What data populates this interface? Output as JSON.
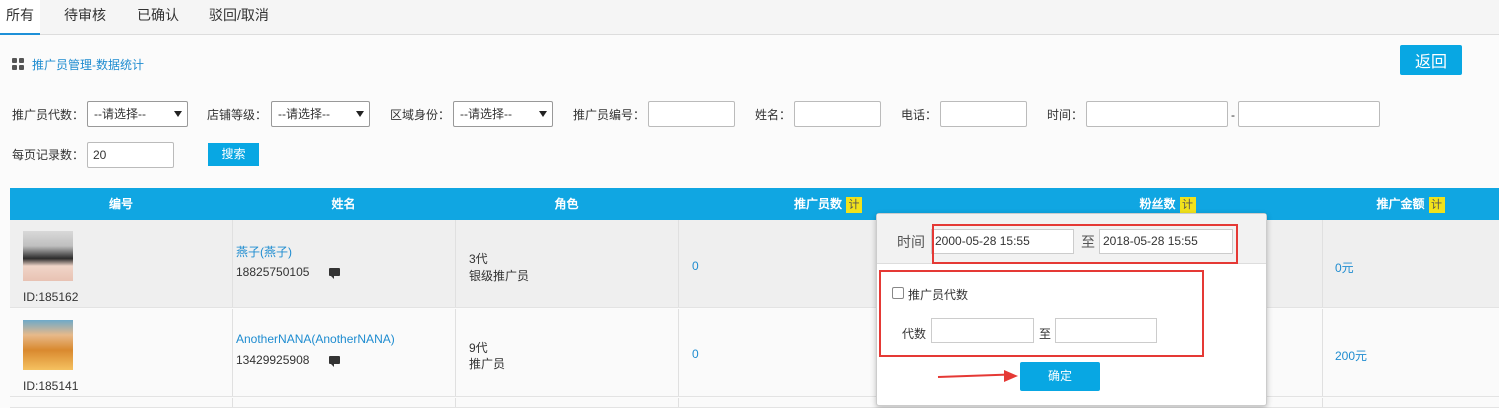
{
  "tabs": [
    "所有",
    "待审核",
    "已确认",
    "驳回/取消"
  ],
  "breadcrumb": "推广员管理-数据统计",
  "back_label": "返回",
  "filters": {
    "level_label": "推广员代数：",
    "level_value": "--请选择--",
    "shop_label": "店铺等级：",
    "shop_value": "--请选择--",
    "region_label": "区域身份：",
    "region_value": "--请选择--",
    "code_label": "推广员编号：",
    "name_label": "姓名：",
    "phone_label": "电话：",
    "time_label": "时间：",
    "time_sep": "-",
    "per_page_label": "每页记录数：",
    "per_page_value": "20",
    "search_label": "搜索"
  },
  "table": {
    "headers": [
      "编号",
      "姓名",
      "角色",
      "推广员数",
      "粉丝数",
      "推广金额"
    ],
    "calc_badge": "计",
    "rows": [
      {
        "id": "ID:185162",
        "name": "燕子(燕子)",
        "phone": "18825750105",
        "gen": "3代",
        "role": "银级推广员",
        "promoters": "0",
        "amount": "0元"
      },
      {
        "id": "ID:185141",
        "name": "AnotherNANA(AnotherNANA)",
        "phone": "13429925908",
        "gen": "9代",
        "role": "推广员",
        "promoters": "0",
        "amount": "200元"
      }
    ]
  },
  "popup": {
    "time_label": "时间",
    "start": "2000-05-28 15:55",
    "to": "至",
    "end": "2018-05-28 15:55",
    "checkbox_label": "推广员代数",
    "gen_label": "代数",
    "gen_to": "至",
    "ok_label": "确定"
  }
}
